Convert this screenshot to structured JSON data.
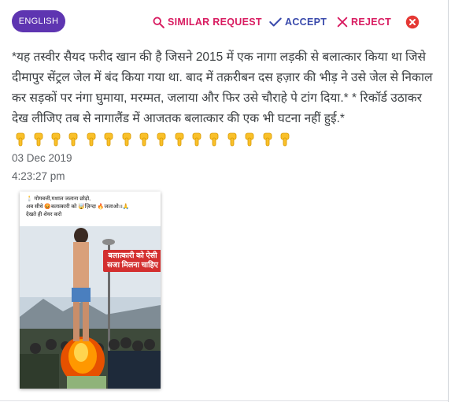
{
  "header": {
    "language_label": "ENGLISH",
    "similar_request_label": "SIMILAR REQUEST",
    "accept_label": "ACCEPT",
    "reject_label": "REJECT"
  },
  "message": {
    "text": "*यह तस्वीर सैयद फरीद खान की है जिसने 2015 में एक नागा लड़की से बलात्कार किया था जिसे दीमापुर सेंट्रल जेल में बंद किया गया था. बाद में तक़रीबन दस हज़ार की भीड़ ने उसे जेल से निकाल कर सड़कों पर नंगा घुमाया, मरम्मत, जलाया और फिर उसे चौराहे पे टांग दिया.* * रिकॉर्ड उठाकर देख लीजिए तब से नागालैंड में आजतक बलात्कार की एक भी घटना नहीं हुई.*",
    "pointer_count": 16,
    "date": "03 Dec 2019",
    "time": "4:23:27 pm"
  },
  "media": {
    "caption_line1": "🕯️ मोमबत्ती,मशाल जलाना छोड़ो,",
    "caption_line2": "अब सीधे 😡बलात्कारी को 🤯ज़िन्दा 🔥जलाओ।।🙏",
    "caption_line3": "देखते ही शेयर करो",
    "overlay_text": "बलात्कारी को ऐसी सजा मिलना चाहिए"
  },
  "colors": {
    "chip_bg": "#5e35b1",
    "accept": "#3949ab",
    "reject": "#d81b60",
    "close": "#e53935"
  }
}
